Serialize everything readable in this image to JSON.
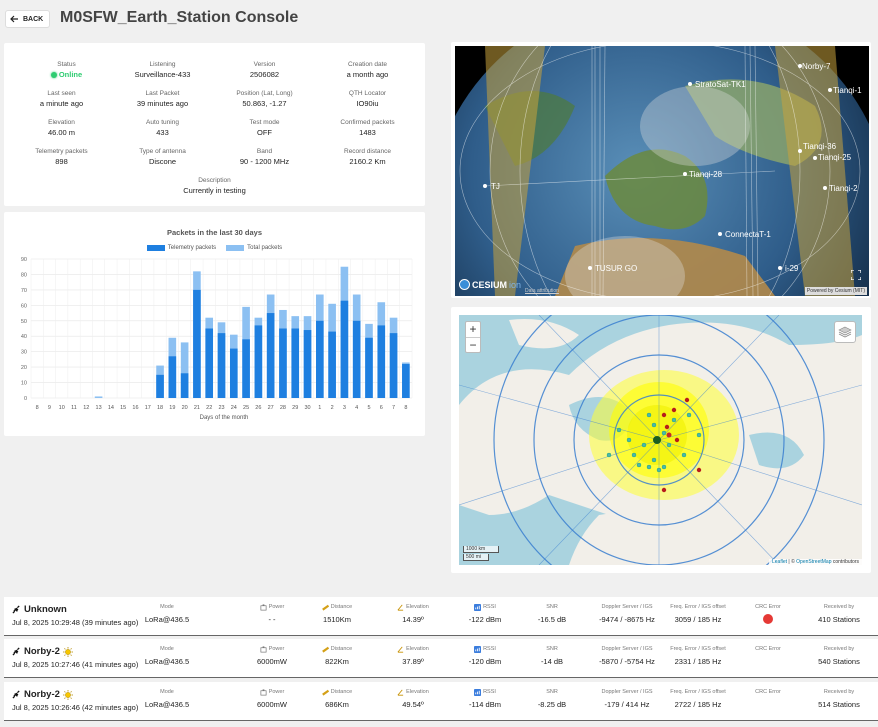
{
  "header": {
    "back_label": "BACK",
    "title": "M0SFW_Earth_Station Console"
  },
  "info": [
    {
      "label": "Status",
      "value": "Online"
    },
    {
      "label": "Listening",
      "value": "Surveillance-433"
    },
    {
      "label": "Version",
      "value": "2506082"
    },
    {
      "label": "Creation date",
      "value": "a month ago"
    },
    {
      "label": "Last seen",
      "value": "a minute ago"
    },
    {
      "label": "Last Packet",
      "value": "39 minutes ago"
    },
    {
      "label": "Position (Lat, Long)",
      "value": "50.863, -1.27"
    },
    {
      "label": "QTH Locator",
      "value": "IO90iu"
    },
    {
      "label": "Elevation",
      "value": "46.00 m"
    },
    {
      "label": "Auto tuning",
      "value": "433"
    },
    {
      "label": "Test mode",
      "value": "OFF"
    },
    {
      "label": "Confirmed packets",
      "value": "1483"
    },
    {
      "label": "Telemetry packets",
      "value": "898"
    },
    {
      "label": "Type of antenna",
      "value": "Discone"
    },
    {
      "label": "Band",
      "value": "90 - 1200 MHz"
    },
    {
      "label": "Record distance",
      "value": "2160.2 Km"
    },
    {
      "label": "Description",
      "value": "Currently in testing"
    }
  ],
  "chart_data": {
    "type": "bar",
    "title": "Packets in the last 30 days",
    "xlabel": "Days of the month",
    "ylabel": "",
    "ylim": [
      0,
      90
    ],
    "yticks": [
      0,
      10,
      20,
      30,
      40,
      50,
      60,
      70,
      80,
      90
    ],
    "categories": [
      "8",
      "9",
      "10",
      "11",
      "12",
      "13",
      "14",
      "15",
      "16",
      "17",
      "18",
      "19",
      "20",
      "21",
      "22",
      "23",
      "24",
      "25",
      "26",
      "27",
      "28",
      "29",
      "30",
      "1",
      "2",
      "3",
      "4",
      "5",
      "6",
      "7",
      "8"
    ],
    "series": [
      {
        "name": "Telemetry packets",
        "color": "#1e7fe0",
        "values": [
          0,
          0,
          0,
          0,
          0,
          0,
          0,
          0,
          0,
          0,
          15,
          27,
          16,
          70,
          45,
          42,
          32,
          38,
          47,
          55,
          45,
          45,
          44,
          50,
          43,
          63,
          50,
          39,
          47,
          42,
          22
        ]
      },
      {
        "name": "Total packets",
        "color": "#8cc0f2",
        "values": [
          0,
          0,
          0,
          0,
          0,
          1,
          0,
          0,
          0,
          0,
          21,
          39,
          36,
          82,
          52,
          49,
          41,
          59,
          52,
          67,
          57,
          53,
          53,
          67,
          61,
          85,
          67,
          48,
          62,
          52,
          23
        ]
      }
    ],
    "stacked": false,
    "grid": true,
    "legend": "top"
  },
  "globe": {
    "labels": [
      "Norby-7",
      "Tianqi-1",
      "StratoSat-TK1",
      "Tianqi-36",
      "Tianqi-25",
      "Tianqi-2",
      "Tianqi-28",
      "TJ",
      "ConnectaT-1",
      "TUSUR GO",
      "i-29"
    ],
    "logo_text": "CESIUM",
    "logo_sub": "ion",
    "data_attr": "Data attribution",
    "powered": "Powered by Cesium (MIT)"
  },
  "map": {
    "zoom_in": "+",
    "zoom_out": "−",
    "scale_km": "1000 km",
    "scale_mi": "500 mi",
    "attr_leaflet": "Leaflet",
    "attr_sep": " | © ",
    "attr_osm": "OpenStreetMap",
    "attr_tail": " contributors"
  },
  "observations": {
    "headers": {
      "mode": "Mode",
      "power": "Power",
      "distance": "Distance",
      "elevation": "Elevation",
      "rssi": "RSSI",
      "snr": "SNR",
      "doppler": "Doppler Server / IGS",
      "freq": "Freq. Error / IGS offset",
      "crc": "CRC Error",
      "received": "Received by"
    },
    "rows": [
      {
        "satellite": "Unknown",
        "sun": false,
        "date": "Jul 8, 2025 10:29:48 (39 minutes ago)",
        "mode": "LoRa@436.5",
        "power": "- -",
        "distance": "1510Km",
        "elevation": "14.39º",
        "rssi": "-122 dBm",
        "snr": "-16.5 dB",
        "doppler": "-9474 / -8675 Hz",
        "freq": "3059 / 185 Hz",
        "crc": true,
        "received": "410 Stations"
      },
      {
        "satellite": "Norby-2",
        "sun": true,
        "date": "Jul 8, 2025 10:27:46 (41 minutes ago)",
        "mode": "LoRa@436.5",
        "power": "6000mW",
        "distance": "822Km",
        "elevation": "37.89º",
        "rssi": "-120 dBm",
        "snr": "-14 dB",
        "doppler": "-5870 / -5754 Hz",
        "freq": "2331 / 185 Hz",
        "crc": false,
        "received": "540 Stations"
      },
      {
        "satellite": "Norby-2",
        "sun": true,
        "date": "Jul 8, 2025 10:26:46 (42 minutes ago)",
        "mode": "LoRa@436.5",
        "power": "6000mW",
        "distance": "686Km",
        "elevation": "49.54º",
        "rssi": "-114 dBm",
        "snr": "-8.25 dB",
        "doppler": "-179 / 414 Hz",
        "freq": "2722 / 185 Hz",
        "crc": false,
        "received": "514 Stations"
      }
    ]
  }
}
